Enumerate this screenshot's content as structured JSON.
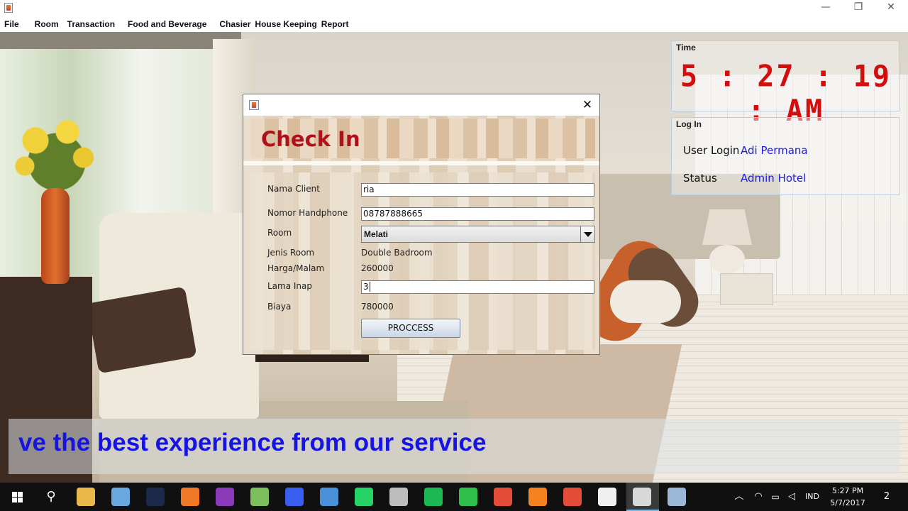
{
  "window": {
    "minimize": "—",
    "maximize": "❐",
    "close": "✕"
  },
  "menu": [
    "File",
    "Room",
    "Transaction",
    "Food and Beverage",
    "Chasier",
    "House Keeping",
    "Report"
  ],
  "time_panel": {
    "title": "Time",
    "clock": "5 : 27 : 19 : AM"
  },
  "login_panel": {
    "title": "Log In",
    "user_label": "User Login",
    "user_value": "Adi Permana",
    "status_label": "Status",
    "status_value": "Admin Hotel"
  },
  "dialog": {
    "close": "✕",
    "heading": "Check In",
    "fields": {
      "nama_client_label": "Nama Client",
      "nama_client_value": "ria",
      "nomor_handphone_label": "Nomor Handphone",
      "nomor_handphone_value": "08787888665",
      "room_label": "Room",
      "room_value": "Melati",
      "jenis_room_label": "Jenis Room",
      "jenis_room_value": "Double Badroom",
      "harga_label": "Harga/Malam",
      "harga_value": "260000",
      "lama_inap_label": "Lama Inap",
      "lama_inap_value": "3",
      "biaya_label": "Biaya",
      "biaya_value": "780000"
    },
    "process_button": "PROCCESS"
  },
  "marquee": "ve the best experience from our service",
  "taskbar": {
    "search_glyph": "⚲",
    "apps": [
      {
        "name": "file-explorer",
        "color": "#e8b84a"
      },
      {
        "name": "virtualbox",
        "color": "#6aa8e0"
      },
      {
        "name": "photoshop",
        "color": "#1c2a4a"
      },
      {
        "name": "xampp",
        "color": "#f07a2a"
      },
      {
        "name": "phpstorm",
        "color": "#8a3ab9"
      },
      {
        "name": "android-studio",
        "color": "#7cbf5a"
      },
      {
        "name": "app-blue",
        "color": "#3a5ef0"
      },
      {
        "name": "network-app",
        "color": "#4a90d9"
      },
      {
        "name": "whatsapp",
        "color": "#25d366"
      },
      {
        "name": "app-gray",
        "color": "#bdbdbd"
      },
      {
        "name": "spotify",
        "color": "#1db954"
      },
      {
        "name": "app-green",
        "color": "#2fbf4a"
      },
      {
        "name": "chrome",
        "color": "#e44d3a"
      },
      {
        "name": "firefox",
        "color": "#f5811f"
      },
      {
        "name": "chrome-2",
        "color": "#e44d3a"
      },
      {
        "name": "app-circle",
        "color": "#f0f0f0"
      },
      {
        "name": "java",
        "color": "#d8d8d8"
      },
      {
        "name": "app-paint",
        "color": "#9ab7d8"
      }
    ],
    "tray": {
      "chevron": "︿",
      "lang": "IND",
      "time": "5:27 PM",
      "date": "5/7/2017",
      "notifications": "2"
    }
  }
}
